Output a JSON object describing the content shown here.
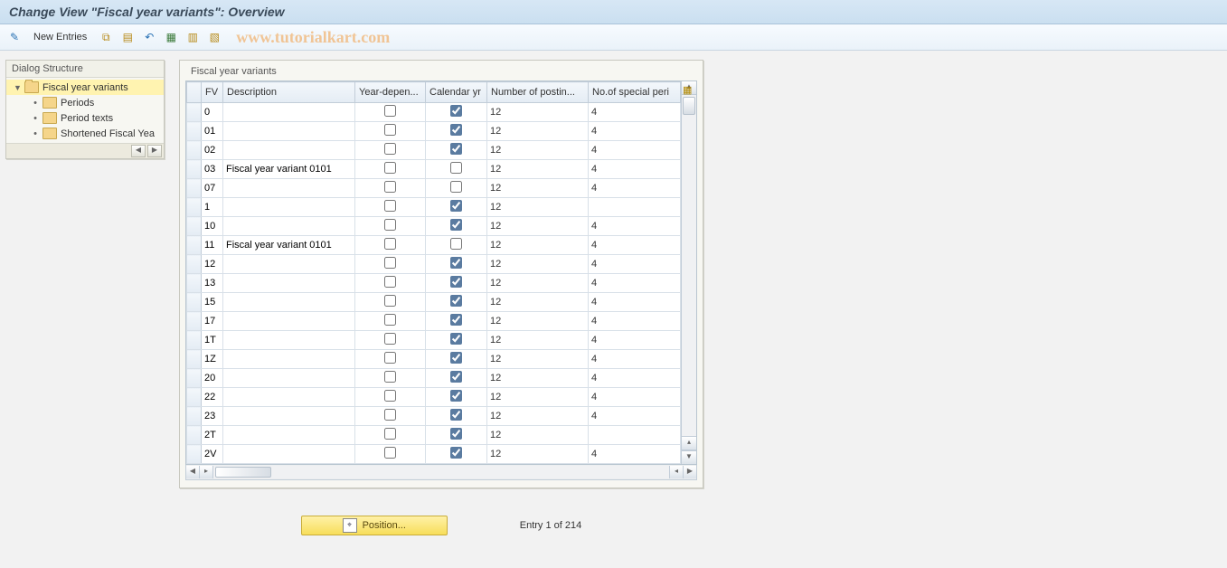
{
  "title": "Change View \"Fiscal year variants\": Overview",
  "watermark": "www.tutorialkart.com",
  "toolbar": {
    "new_entries": "New Entries",
    "icons": [
      {
        "name": "glasses-edit-icon",
        "glyph": "✎"
      },
      {
        "name": "copy-icon",
        "glyph": "📋"
      },
      {
        "name": "delete-icon",
        "glyph": "🗑"
      },
      {
        "name": "undo-icon",
        "glyph": "↩"
      },
      {
        "name": "select-all-icon",
        "glyph": "☰"
      },
      {
        "name": "select-block-icon",
        "glyph": "▦"
      },
      {
        "name": "deselect-icon",
        "glyph": "▥"
      }
    ]
  },
  "tree": {
    "title": "Dialog Structure",
    "root": "Fiscal year variants",
    "children": [
      "Periods",
      "Period texts",
      "Shortened Fiscal Yea"
    ]
  },
  "table": {
    "caption": "Fiscal year variants",
    "columns": {
      "sel": "",
      "fv": "FV",
      "desc": "Description",
      "yd": "Year-depen...",
      "cy": "Calendar yr",
      "np": "Number of postin...",
      "sp": "No.of special peri"
    },
    "rows": [
      {
        "fv": "0",
        "desc": "",
        "yd": false,
        "cy": true,
        "np": "12",
        "sp": "4"
      },
      {
        "fv": "01",
        "desc": "",
        "yd": false,
        "cy": true,
        "np": "12",
        "sp": "4"
      },
      {
        "fv": "02",
        "desc": "",
        "yd": false,
        "cy": true,
        "np": "12",
        "sp": "4"
      },
      {
        "fv": "03",
        "desc": "Fiscal year variant 0101",
        "yd": false,
        "cy": false,
        "np": "12",
        "sp": "4"
      },
      {
        "fv": "07",
        "desc": "",
        "yd": false,
        "cy": false,
        "np": "12",
        "sp": "4"
      },
      {
        "fv": "1",
        "desc": "",
        "yd": false,
        "cy": true,
        "np": "12",
        "sp": ""
      },
      {
        "fv": "10",
        "desc": "",
        "yd": false,
        "cy": true,
        "np": "12",
        "sp": "4"
      },
      {
        "fv": "11",
        "desc": "Fiscal year variant 0101",
        "yd": false,
        "cy": false,
        "np": "12",
        "sp": "4"
      },
      {
        "fv": "12",
        "desc": "",
        "yd": false,
        "cy": true,
        "np": "12",
        "sp": "4"
      },
      {
        "fv": "13",
        "desc": "",
        "yd": false,
        "cy": true,
        "np": "12",
        "sp": "4"
      },
      {
        "fv": "15",
        "desc": "",
        "yd": false,
        "cy": true,
        "np": "12",
        "sp": "4"
      },
      {
        "fv": "17",
        "desc": "",
        "yd": false,
        "cy": true,
        "np": "12",
        "sp": "4"
      },
      {
        "fv": "1T",
        "desc": "",
        "yd": false,
        "cy": true,
        "np": "12",
        "sp": "4"
      },
      {
        "fv": "1Z",
        "desc": "",
        "yd": false,
        "cy": true,
        "np": "12",
        "sp": "4"
      },
      {
        "fv": "20",
        "desc": "",
        "yd": false,
        "cy": true,
        "np": "12",
        "sp": "4"
      },
      {
        "fv": "22",
        "desc": "",
        "yd": false,
        "cy": true,
        "np": "12",
        "sp": "4"
      },
      {
        "fv": "23",
        "desc": "",
        "yd": false,
        "cy": true,
        "np": "12",
        "sp": "4"
      },
      {
        "fv": "2T",
        "desc": "",
        "yd": false,
        "cy": true,
        "np": "12",
        "sp": ""
      },
      {
        "fv": "2V",
        "desc": "",
        "yd": false,
        "cy": true,
        "np": "12",
        "sp": "4"
      }
    ]
  },
  "footer": {
    "position_label": "Position...",
    "entry_status": "Entry 1 of 214"
  }
}
